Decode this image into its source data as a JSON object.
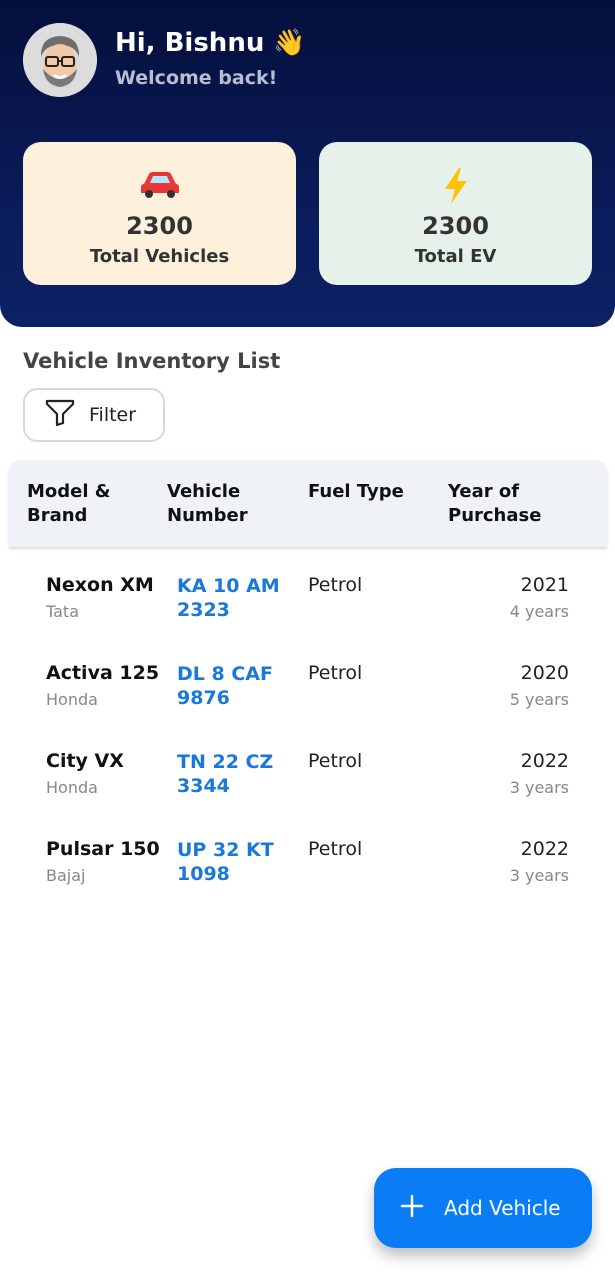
{
  "header": {
    "greeting": "Hi, Bishnu 👋",
    "welcome": "Welcome back!"
  },
  "stats": [
    {
      "icon": "car-icon",
      "value": "2300",
      "label": "Total Vehicles"
    },
    {
      "icon": "lightning-icon",
      "value": "2300",
      "label": "Total EV"
    }
  ],
  "inventory": {
    "title": "Vehicle Inventory List",
    "filter_label": "Filter",
    "columns": [
      "Model & Brand",
      "Vehicle Number",
      "Fuel Type",
      "Year of Purchase"
    ],
    "rows": [
      {
        "model": "Nexon XM",
        "brand": "Tata",
        "number": "KA 10 AM 2323",
        "fuel": "Petrol",
        "year": "2021",
        "age": "4 years"
      },
      {
        "model": "Activa 125",
        "brand": "Honda",
        "number": "DL 8 CAF 9876",
        "fuel": "Petrol",
        "year": "2020",
        "age": "5 years"
      },
      {
        "model": "City VX",
        "brand": "Honda",
        "number": "TN 22 CZ 3344",
        "fuel": "Petrol",
        "year": "2022",
        "age": "3 years"
      },
      {
        "model": "Pulsar 150",
        "brand": "Bajaj",
        "number": "UP 32 KT 1098",
        "fuel": "Petrol",
        "year": "2022",
        "age": "3 years"
      }
    ]
  },
  "fab": {
    "label": "Add Vehicle"
  },
  "colors": {
    "header": "#0a1b58",
    "accent": "#0a7cf4",
    "vehicle_card": "#fdf1dc",
    "ev_card": "#e6f2e9"
  }
}
